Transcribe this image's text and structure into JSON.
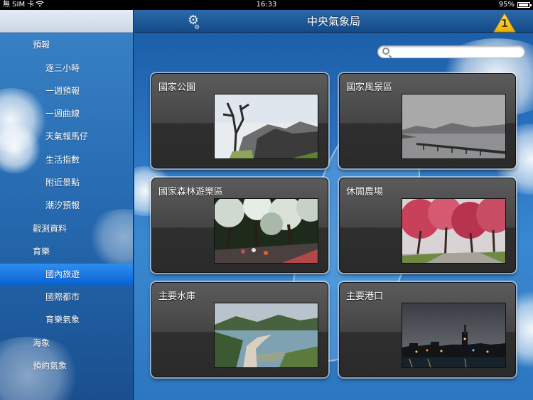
{
  "status_bar": {
    "carrier": "無 SIM 卡",
    "time": "16:33",
    "battery": "95%"
  },
  "navbar": {
    "title": "中央氣象局",
    "alert_count": "1"
  },
  "search": {
    "value": "",
    "placeholder": ""
  },
  "sidebar": {
    "items": [
      {
        "label": "預報",
        "level": 1
      },
      {
        "label": "逐三小時",
        "level": 2
      },
      {
        "label": "一週預報",
        "level": 2
      },
      {
        "label": "一週曲線",
        "level": 2
      },
      {
        "label": "天氣報馬仔",
        "level": 2
      },
      {
        "label": "生活指數",
        "level": 2
      },
      {
        "label": "附近景點",
        "level": 2
      },
      {
        "label": "潮汐預報",
        "level": 2
      },
      {
        "label": "觀測資料",
        "level": 1
      },
      {
        "label": "育樂",
        "level": 1
      },
      {
        "label": "國內旅遊",
        "level": 2,
        "selected": true
      },
      {
        "label": "國際都市",
        "level": 2
      },
      {
        "label": "育樂氣象",
        "level": 2
      },
      {
        "label": "海象",
        "level": 1
      },
      {
        "label": "預約氣象",
        "level": 1
      }
    ]
  },
  "cards": [
    {
      "label": "國家公園",
      "photo": "mountain-tree-photo"
    },
    {
      "label": "國家風景區",
      "photo": "lake-pier-photo"
    },
    {
      "label": "國家森林遊樂區",
      "photo": "cherry-forest-photo"
    },
    {
      "label": "休閒農場",
      "photo": "pink-blossom-path-photo"
    },
    {
      "label": "主要水庫",
      "photo": "reservoir-photo"
    },
    {
      "label": "主要港口",
      "photo": "harbor-night-photo"
    }
  ],
  "colors": {
    "selected_row": "#0a62d4",
    "navbar": "#134a86",
    "alert": "#f5c400"
  }
}
